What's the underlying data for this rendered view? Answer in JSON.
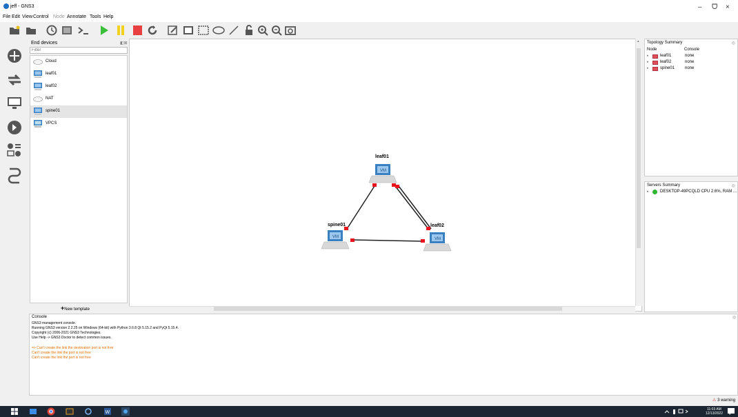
{
  "window": {
    "title": "jeff - GNS3",
    "minimize": "–",
    "restore": "ᗜ",
    "close": "×"
  },
  "menu": [
    "File",
    "Edit",
    "View",
    "Control",
    "Node",
    "Annotate",
    "Tools",
    "Help"
  ],
  "toolbar_icons": [
    "folder-open-icon",
    "folder-icon",
    "clock-icon",
    "screenshot-icon",
    "console-icon",
    "start-icon",
    "pause-icon",
    "stop-icon",
    "reload-icon",
    "note-icon",
    "image-icon",
    "rectangle-icon",
    "ellipse-icon",
    "line-icon",
    "lock-icon",
    "zoom-in-icon",
    "zoom-out-icon",
    "camera-icon"
  ],
  "left_icons": [
    "browse-routers-icon",
    "browse-switches-icon",
    "browse-end-devices-icon",
    "browse-security-icon",
    "browse-all-devices-icon",
    "add-link-icon"
  ],
  "devices_panel": {
    "title": "End devices",
    "filter_placeholder": "Filter",
    "items": [
      {
        "label": "Cloud",
        "icon": "cloud-icon"
      },
      {
        "label": "leaf01",
        "icon": "vm-icon"
      },
      {
        "label": "leaf02",
        "icon": "vm-icon"
      },
      {
        "label": "NAT",
        "icon": "cloud-icon"
      },
      {
        "label": "spine01",
        "icon": "vm-icon"
      },
      {
        "label": "VPCS",
        "icon": "vpcs-icon"
      }
    ],
    "new_template": "New template"
  },
  "topology_summary": {
    "title": "Topology Summary",
    "col_node": "Node",
    "col_console": "Console",
    "rows": [
      {
        "node": "leaf01",
        "console": "none"
      },
      {
        "node": "leaf02",
        "console": "none"
      },
      {
        "node": "spine01",
        "console": "none"
      }
    ]
  },
  "servers_summary": {
    "title": "Servers Summary",
    "server": "DESKTOP-49PCQLD CPU 2.6%, RAM ..."
  },
  "canvas": {
    "nodes": [
      {
        "name": "leaf01"
      },
      {
        "name": "leaf02"
      },
      {
        "name": "spine01"
      }
    ]
  },
  "console": {
    "title": "Console",
    "lines": [
      "GNS3 management console.",
      "Running GNS3 version 2.2.25 on Windows (64-bit) with Python 3.6.8 Qt 5.15.2 and PyQt 5.15.4.",
      "Copyright (c) 2006-2021 GNS3 Technologies.",
      "Use Help -> GNS3 Doctor to detect common issues."
    ],
    "warnings": [
      "=> Can't create the link the destination port is not free",
      "Can't create the link the port is not free",
      "Can't create the link the port is not free"
    ]
  },
  "status": {
    "warnings": "3 warning"
  },
  "taskbar": {
    "time": "11:03 AM",
    "date": "12/13/2022"
  },
  "colors": {
    "link_endpoint": "#e8141e",
    "node_icon": "#3a7fc0",
    "warning": "#e07000"
  }
}
